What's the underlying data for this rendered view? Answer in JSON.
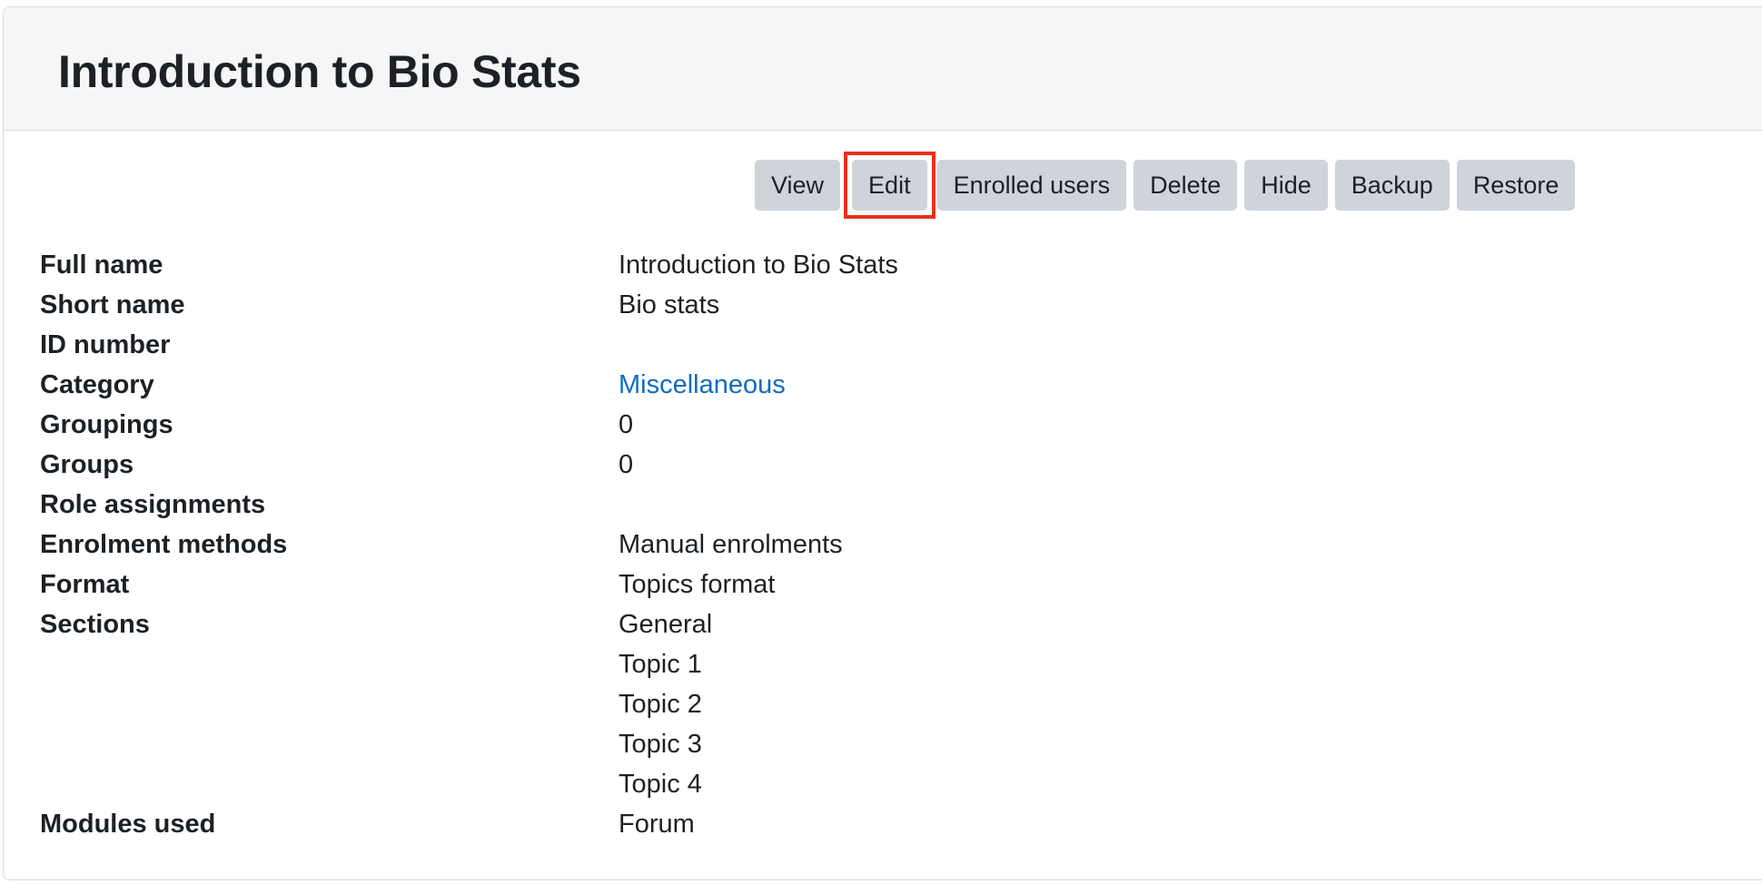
{
  "course": {
    "title": "Introduction to Bio Stats"
  },
  "actions": {
    "view": "View",
    "edit": "Edit",
    "enrolled_users": "Enrolled users",
    "delete": "Delete",
    "hide": "Hide",
    "backup": "Backup",
    "restore": "Restore",
    "highlight_color": "#e8301c"
  },
  "details": {
    "full_name": {
      "label": "Full name",
      "value": "Introduction to Bio Stats"
    },
    "short_name": {
      "label": "Short name",
      "value": "Bio stats"
    },
    "id_number": {
      "label": "ID number",
      "value": ""
    },
    "category": {
      "label": "Category",
      "value": "Miscellaneous"
    },
    "groupings": {
      "label": "Groupings",
      "value": "0"
    },
    "groups": {
      "label": "Groups",
      "value": "0"
    },
    "role_assignments": {
      "label": "Role assignments",
      "value": ""
    },
    "enrolment_methods": {
      "label": "Enrolment methods",
      "value": "Manual enrolments"
    },
    "format": {
      "label": "Format",
      "value": "Topics format"
    },
    "sections": {
      "label": "Sections",
      "values": [
        "General",
        "Topic 1",
        "Topic 2",
        "Topic 3",
        "Topic 4"
      ]
    },
    "modules_used": {
      "label": "Modules used",
      "value": "Forum"
    }
  },
  "colors": {
    "link": "#0f6cbf",
    "button_bg": "#ced4da",
    "header_bg": "#f6f6f6"
  }
}
